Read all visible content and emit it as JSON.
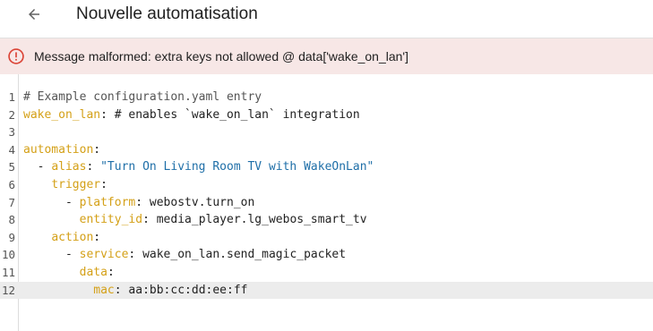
{
  "header": {
    "title": "Nouvelle automatisation",
    "back_icon": "arrow-left-icon"
  },
  "error": {
    "icon": "alert-circle-icon",
    "color": "#db4437",
    "message": "Message malformed: extra keys not allowed @ data['wake_on_lan']"
  },
  "editor": {
    "colors": {
      "key": "#d4a017",
      "string": "#1f6fa8",
      "comment": "#555555",
      "active_line": "#ececec"
    },
    "active_line": 12,
    "lines": [
      {
        "n": "1",
        "indent": "",
        "t1": "# Example configuration.yaml entry",
        "k": "",
        "sep": "",
        "v": "",
        "s": ""
      },
      {
        "n": "2",
        "indent": "",
        "t1": "",
        "k": "wake_on_lan",
        "sep": ": ",
        "v": "# enables `wake_on_lan` integration",
        "s": ""
      },
      {
        "n": "3",
        "indent": "",
        "t1": "",
        "k": "",
        "sep": "",
        "v": "",
        "s": ""
      },
      {
        "n": "4",
        "indent": "",
        "t1": "",
        "k": "automation",
        "sep": ":",
        "v": "",
        "s": ""
      },
      {
        "n": "5",
        "indent": "  - ",
        "t1": "",
        "k": "alias",
        "sep": ": ",
        "v": "",
        "s": "\"Turn On Living Room TV with WakeOnLan\""
      },
      {
        "n": "6",
        "indent": "    ",
        "t1": "",
        "k": "trigger",
        "sep": ":",
        "v": "",
        "s": ""
      },
      {
        "n": "7",
        "indent": "      - ",
        "t1": "",
        "k": "platform",
        "sep": ": ",
        "v": "webostv.turn_on",
        "s": ""
      },
      {
        "n": "8",
        "indent": "        ",
        "t1": "",
        "k": "entity_id",
        "sep": ": ",
        "v": "media_player.lg_webos_smart_tv",
        "s": ""
      },
      {
        "n": "9",
        "indent": "    ",
        "t1": "",
        "k": "action",
        "sep": ":",
        "v": "",
        "s": ""
      },
      {
        "n": "10",
        "indent": "      - ",
        "t1": "",
        "k": "service",
        "sep": ": ",
        "v": "wake_on_lan.send_magic_packet",
        "s": ""
      },
      {
        "n": "11",
        "indent": "        ",
        "t1": "",
        "k": "data",
        "sep": ":",
        "v": "",
        "s": ""
      },
      {
        "n": "12",
        "indent": "          ",
        "t1": "",
        "k": "mac",
        "sep": ": ",
        "v": "aa:bb:cc:dd:ee:ff",
        "s": ""
      }
    ]
  }
}
